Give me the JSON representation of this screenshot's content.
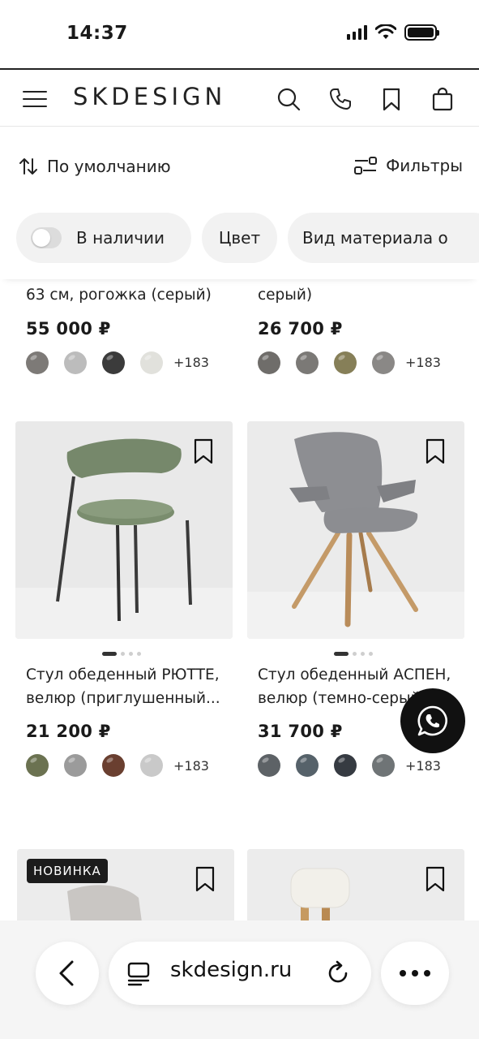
{
  "status_bar": {
    "time": "14:37"
  },
  "header": {
    "logo": "SKDESIGN",
    "icons": [
      "menu-icon",
      "search-icon",
      "phone-icon",
      "bookmark-icon",
      "bag-icon"
    ]
  },
  "toolbar": {
    "sort_label": "По умолчанию",
    "filter_label": "Фильтры"
  },
  "chips": {
    "in_stock": {
      "label": "В наличии",
      "enabled": false
    },
    "color": "Цвет",
    "material": "Вид материала о"
  },
  "products": [
    {
      "title": "63 см, рогожка (серый)",
      "price": "55 000 ₽",
      "swatches": [
        "#7d7a77",
        "#bcbcbc",
        "#3b3b3b",
        "#e1e1dc"
      ],
      "more": "+183"
    },
    {
      "title": "серый)",
      "price": "26 700 ₽",
      "swatches": [
        "#6f6d6a",
        "#7b7976",
        "#867f58",
        "#8a8886"
      ],
      "more": "+183"
    },
    {
      "title": "Стул обеденный РЮТТЕ, велюр (приглушенный...",
      "price": "21 200 ₽",
      "swatches": [
        "#6b7251",
        "#9b9b9b",
        "#6a3f30",
        "#c9c9c9"
      ],
      "more": "+183",
      "carousel": {
        "count": 4,
        "active": 1
      }
    },
    {
      "title": "Стул обеденный АСПЕН, велюр (темно-серый)",
      "price": "31 700 ₽",
      "swatches": [
        "#5d6266",
        "#56626a",
        "#363b42",
        "#6f7476"
      ],
      "more": "+183",
      "carousel": {
        "count": 4,
        "active": 1
      }
    },
    {
      "badge": "НОВИНКА"
    },
    {}
  ],
  "browser": {
    "url": "skdesign.ru"
  },
  "colors": {
    "accent": "#1a1a1a",
    "chip_bg": "#f2f2f2",
    "badge_bg": "#1c1c1c"
  }
}
